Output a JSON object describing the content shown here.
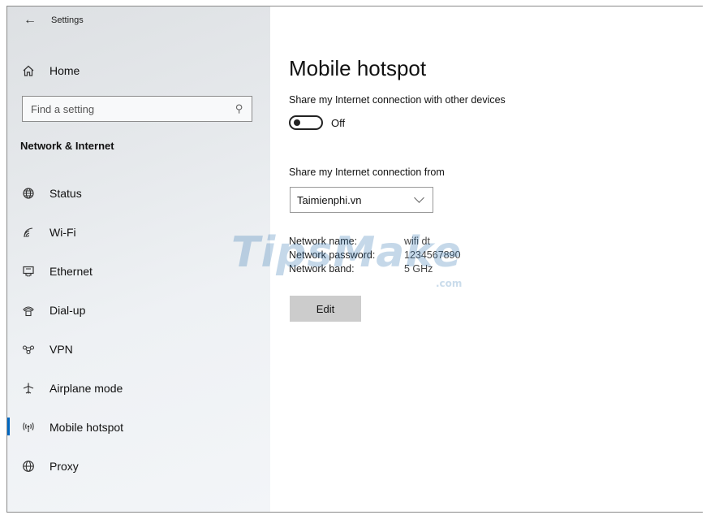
{
  "window": {
    "title": "Settings"
  },
  "sidebar": {
    "home_label": "Home",
    "search_placeholder": "Find a setting",
    "section_heading": "Network & Internet",
    "items": [
      {
        "label": "Status",
        "icon": "globe-status-icon"
      },
      {
        "label": "Wi-Fi",
        "icon": "wifi-icon"
      },
      {
        "label": "Ethernet",
        "icon": "ethernet-icon"
      },
      {
        "label": "Dial-up",
        "icon": "dial-up-icon"
      },
      {
        "label": "VPN",
        "icon": "vpn-icon"
      },
      {
        "label": "Airplane mode",
        "icon": "airplane-icon"
      },
      {
        "label": "Mobile hotspot",
        "icon": "hotspot-icon",
        "active": true
      },
      {
        "label": "Proxy",
        "icon": "globe-icon"
      }
    ]
  },
  "main": {
    "title": "Mobile hotspot",
    "share_label": "Share my Internet connection with other devices",
    "toggle_state": "Off",
    "share_from_label": "Share my Internet connection from",
    "share_from_value": "Taimienphi.vn",
    "network_name_label": "Network name:",
    "network_name_value": "wifi dt",
    "network_password_label": "Network password:",
    "network_password_value": "1234567890",
    "network_band_label": "Network band:",
    "network_band_value": "5 GHz",
    "edit_label": "Edit"
  },
  "watermark": {
    "text": "TipsMake",
    "suffix": ".com"
  },
  "colors": {
    "accent": "#0067c0",
    "button_bg": "#cccccc"
  }
}
